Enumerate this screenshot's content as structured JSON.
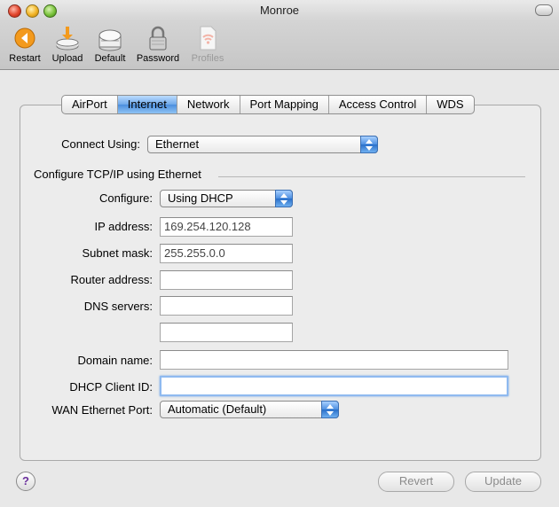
{
  "window": {
    "title": "Monroe"
  },
  "toolbar": {
    "items": [
      {
        "label": "Restart",
        "icon": "restart-icon",
        "enabled": true
      },
      {
        "label": "Upload",
        "icon": "upload-icon",
        "enabled": true
      },
      {
        "label": "Default",
        "icon": "default-icon",
        "enabled": true
      },
      {
        "label": "Password",
        "icon": "lock-icon",
        "enabled": true
      },
      {
        "label": "Profiles",
        "icon": "profiles-icon",
        "enabled": false
      }
    ]
  },
  "tabs": [
    {
      "label": "AirPort",
      "active": false
    },
    {
      "label": "Internet",
      "active": true
    },
    {
      "label": "Network",
      "active": false
    },
    {
      "label": "Port Mapping",
      "active": false
    },
    {
      "label": "Access Control",
      "active": false
    },
    {
      "label": "WDS",
      "active": false
    }
  ],
  "form": {
    "connect_using": {
      "label": "Connect Using:",
      "value": "Ethernet"
    },
    "section_title": "Configure TCP/IP using Ethernet",
    "configure": {
      "label": "Configure:",
      "value": "Using DHCP"
    },
    "ip_address": {
      "label": "IP address:",
      "value": "169.254.120.128"
    },
    "subnet_mask": {
      "label": "Subnet mask:",
      "value": "255.255.0.0"
    },
    "router_address": {
      "label": "Router address:",
      "value": ""
    },
    "dns_servers": {
      "label": "DNS servers:",
      "value1": "",
      "value2": ""
    },
    "domain_name": {
      "label": "Domain name:",
      "value": ""
    },
    "dhcp_client_id": {
      "label": "DHCP Client ID:",
      "value": ""
    },
    "wan_port": {
      "label": "WAN Ethernet Port:",
      "value": "Automatic (Default)"
    }
  },
  "footer": {
    "help_label": "?",
    "revert_label": "Revert",
    "update_label": "Update"
  }
}
